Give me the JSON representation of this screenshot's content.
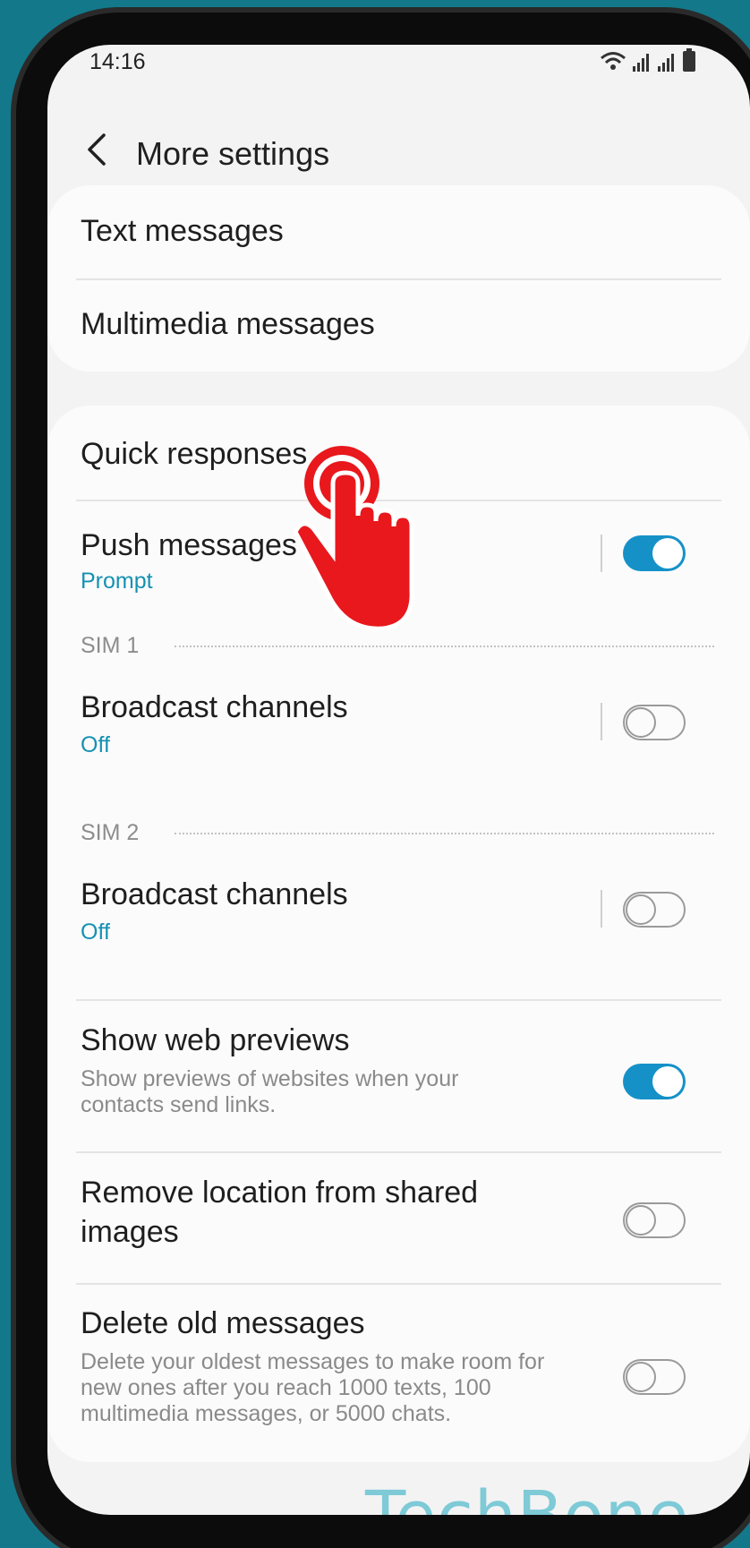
{
  "status": {
    "time": "14:16"
  },
  "header": {
    "title": "More settings"
  },
  "group1": {
    "items": [
      "Text messages",
      "Multimedia messages"
    ]
  },
  "group2": {
    "quick_responses": "Quick responses",
    "push": {
      "title": "Push messages",
      "subtitle": "Prompt",
      "enabled": true
    },
    "sim1": {
      "label": "SIM 1",
      "title": "Broadcast channels",
      "subtitle": "Off",
      "enabled": false
    },
    "sim2": {
      "label": "SIM 2",
      "title": "Broadcast channels",
      "subtitle": "Off",
      "enabled": false
    },
    "web_previews": {
      "title": "Show web previews",
      "description": "Show previews of websites when your contacts send links.",
      "enabled": true
    },
    "remove_location": {
      "title_line1": "Remove location from shared",
      "title_line2": "images",
      "enabled": false
    },
    "delete_old": {
      "title": "Delete old messages",
      "description": "Delete your oldest messages to make room for new ones after you reach 1000 texts, 100 multimedia messages, or 5000 chats.",
      "enabled": false
    }
  },
  "watermark": "TechBone",
  "colors": {
    "accent": "#1591c8",
    "link_text": "#1591b3",
    "background": "#13788a",
    "tap_hand": "#e8181d"
  }
}
